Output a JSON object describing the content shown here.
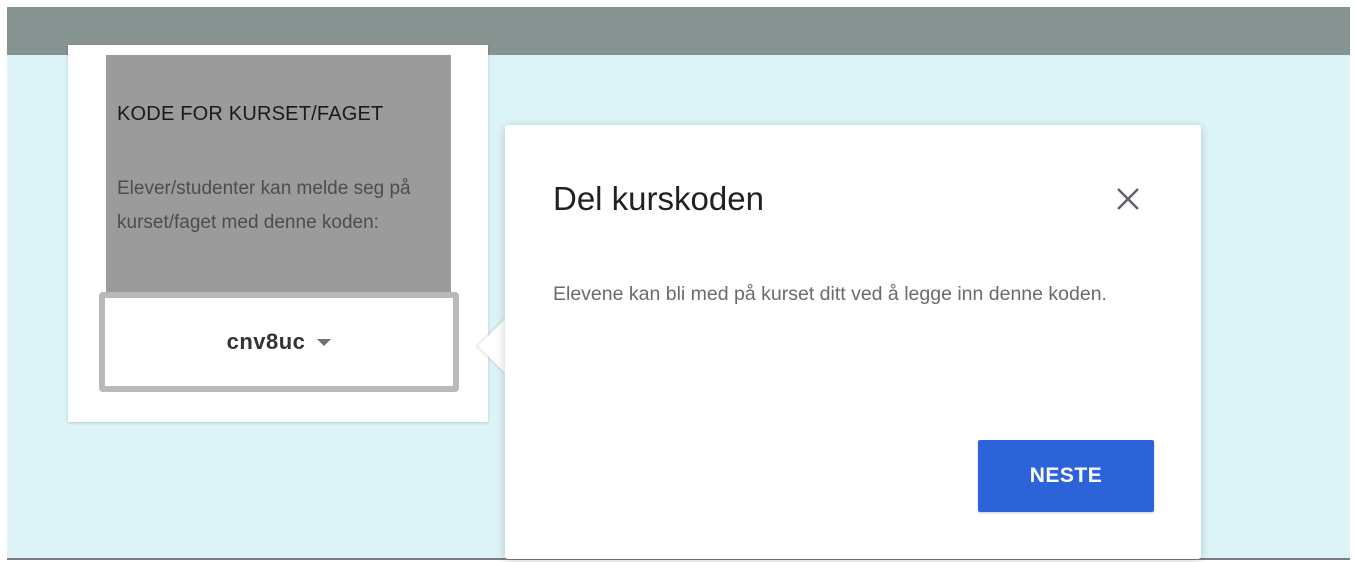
{
  "course_code_card": {
    "title": "KODE FOR KURSET/FAGET",
    "description": "Elever/studenter kan melde seg på kurset/faget med denne koden:",
    "code": "cnv8uc"
  },
  "popover": {
    "title": "Del kurskoden",
    "text": "Elevene kan bli med på kurset ditt ved å legge inn denne koden.",
    "next_label": "NESTE"
  },
  "icons": {
    "close": "close-icon",
    "dropdown": "chevron-down-icon"
  },
  "colors": {
    "top_bar": "#869391",
    "background": "#dcf4f8",
    "primary_button": "#2d63d8"
  }
}
